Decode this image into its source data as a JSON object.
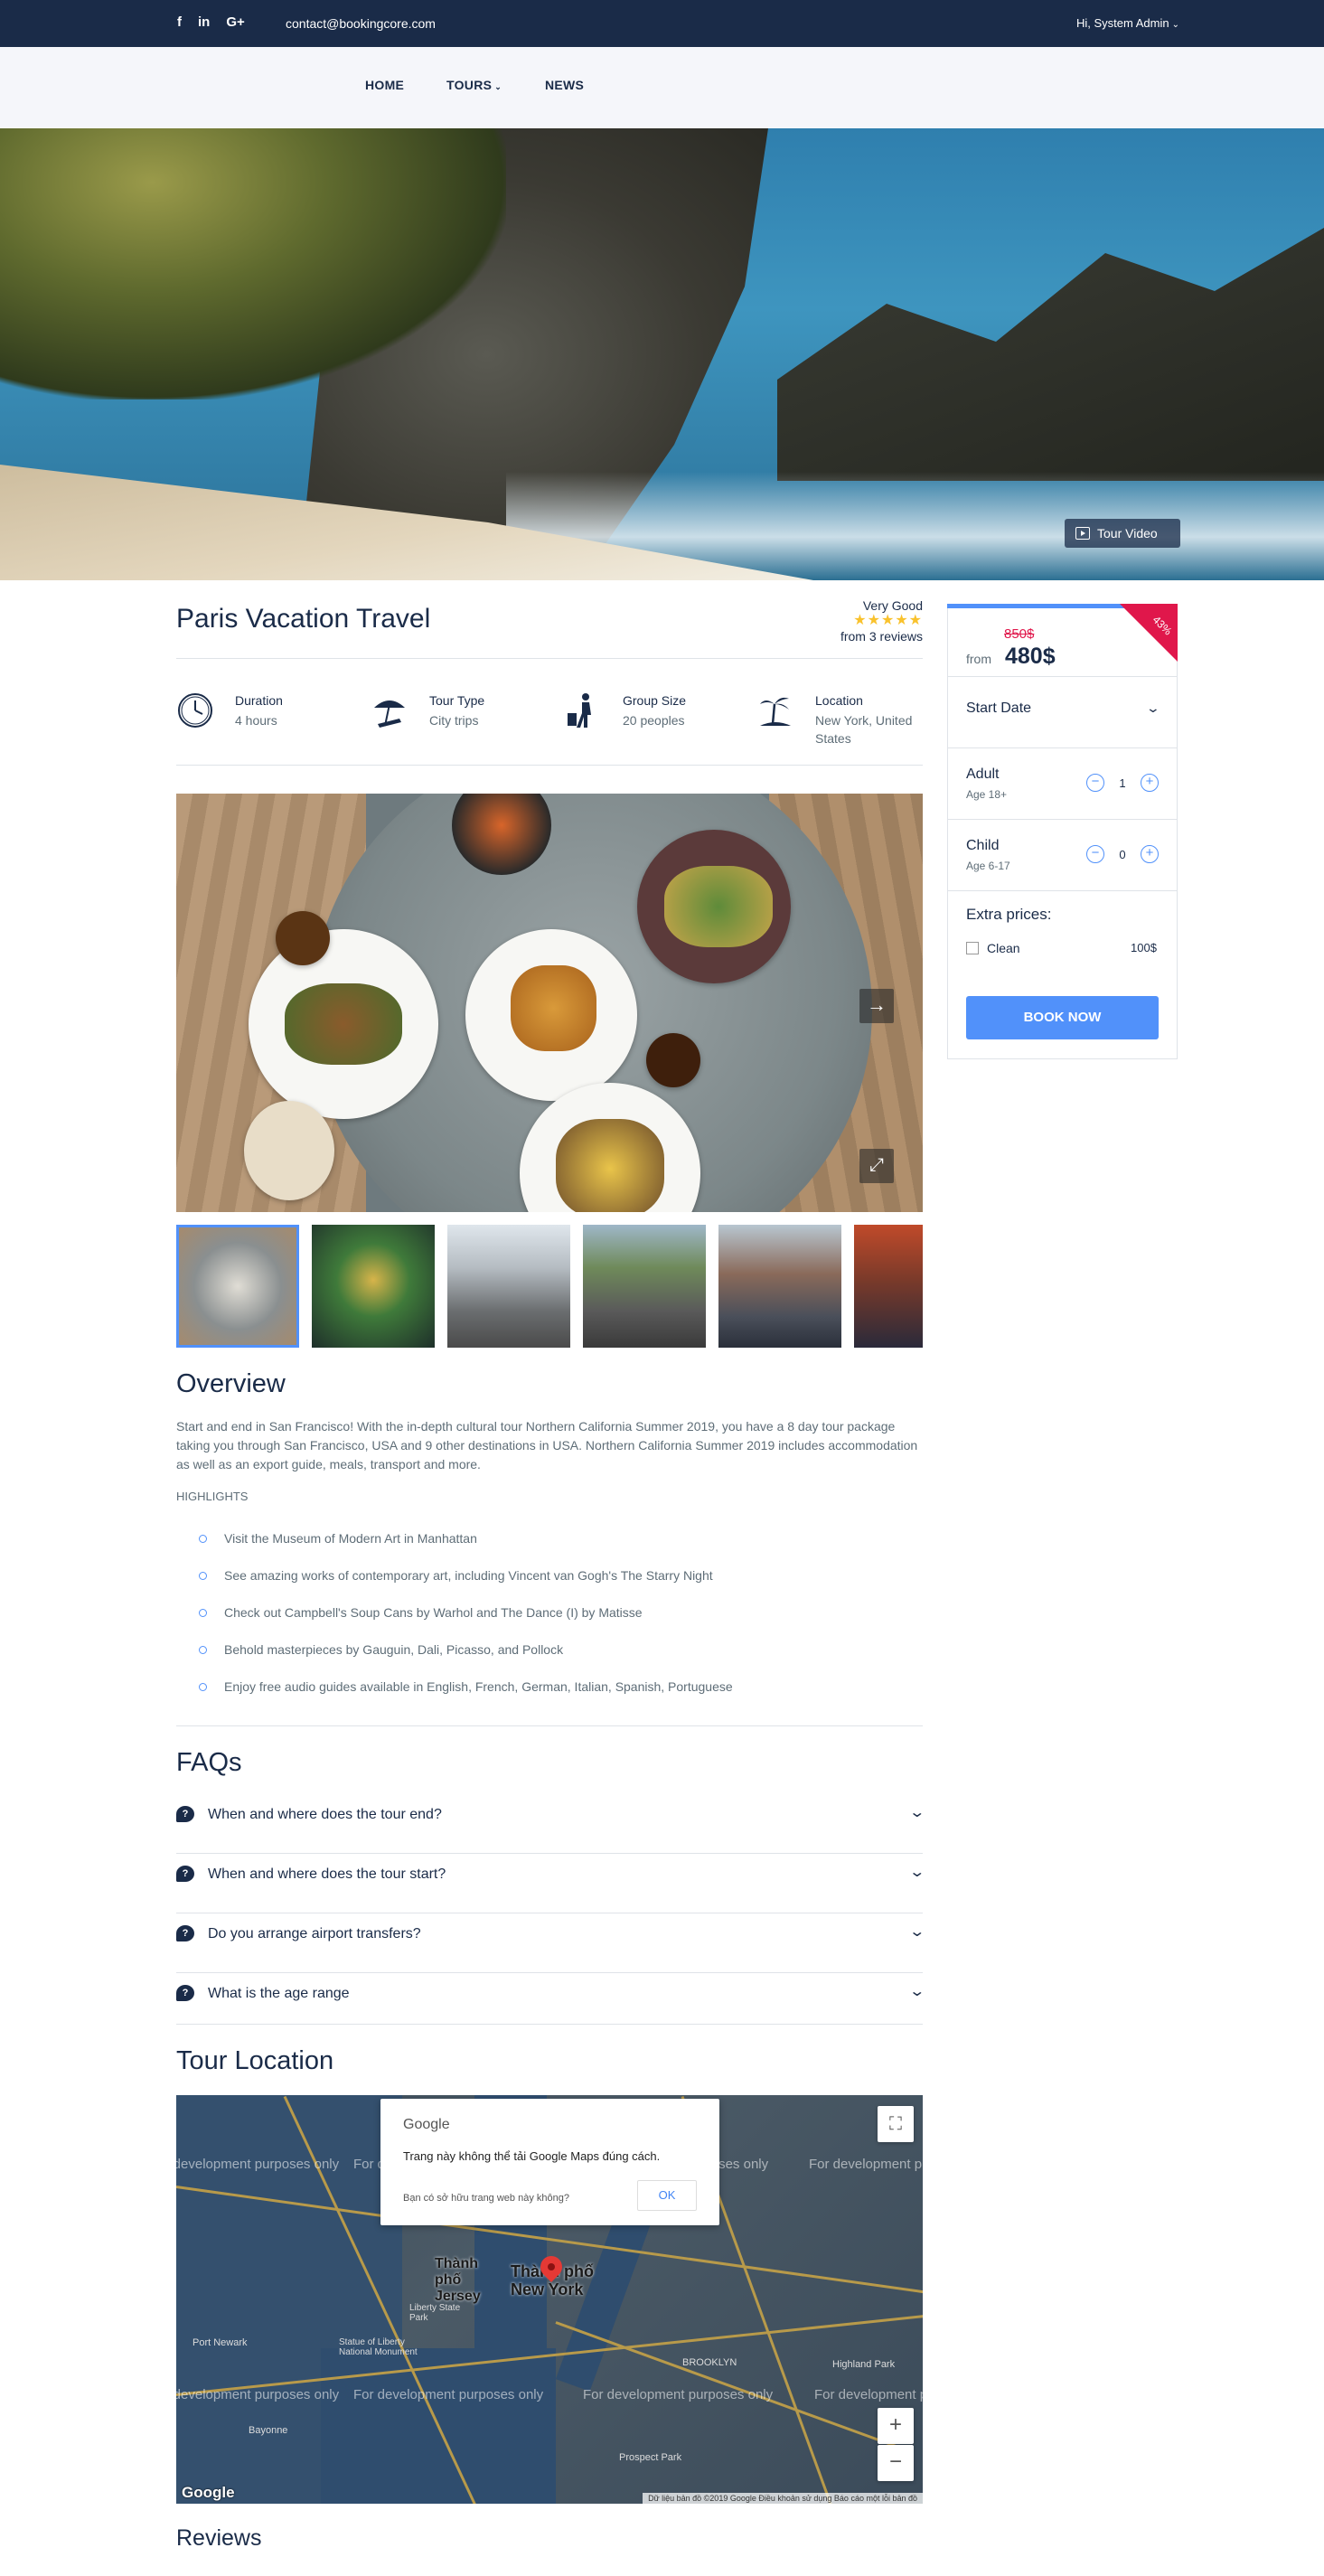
{
  "topbar": {
    "social": [
      "f",
      "in",
      "G+"
    ],
    "email": "contact@bookingcore.com",
    "user": "Hi, System Admin",
    "user_caret": "⌄"
  },
  "nav": {
    "items": [
      {
        "label": "HOME"
      },
      {
        "label": "TOURS",
        "dropdown": true
      },
      {
        "label": "NEWS"
      }
    ],
    "caret": "⌄"
  },
  "hero": {
    "video_label": "Tour Video"
  },
  "tour": {
    "title": "Paris Vacation Travel",
    "rating_label": "Very Good",
    "stars": "★★★★★",
    "rating_value": 5,
    "reviews": "from 3 reviews"
  },
  "info": [
    {
      "label": "Duration",
      "value": "4 hours",
      "icon": "clock-icon"
    },
    {
      "label": "Tour Type",
      "value": "City trips",
      "icon": "beach-umbrella-icon"
    },
    {
      "label": "Group Size",
      "value": "20 peoples",
      "icon": "traveler-icon"
    },
    {
      "label": "Location",
      "value": "New York, United States",
      "icon": "palm-island-icon"
    }
  ],
  "gallery": {
    "next_icon": "→",
    "fullscreen_icon": "⤢",
    "thumbs": [
      "food-table",
      "salad-bowl",
      "city-street",
      "motorbike-rider",
      "market-street",
      "night-street"
    ]
  },
  "overview": {
    "heading": "Overview",
    "text": "Start and end in San Francisco! With the in-depth cultural tour Northern California Summer 2019, you have a 8 day tour package taking you through San Francisco, USA and 9 other destinations in USA. Northern California Summer 2019 includes accommodation as well as an export guide, meals, transport and more.",
    "highlights_title": "HIGHLIGHTS",
    "highlights": [
      "Visit the Museum of Modern Art in Manhattan",
      "See amazing works of contemporary art, including Vincent van Gogh's The Starry Night",
      "Check out Campbell's Soup Cans by Warhol and The Dance (I) by Matisse",
      "Behold masterpieces by Gauguin, Dali, Picasso, and Pollock",
      "Enjoy free audio guides available in English, French, German, Italian, Spanish, Portuguese"
    ]
  },
  "faqs": {
    "heading": "FAQs",
    "icon": "?",
    "chevron": "⌄",
    "items": [
      "When and where does the tour end?",
      "When and where does the tour start?",
      "Do you arrange airport transfers?",
      "What is the age range"
    ]
  },
  "location": {
    "heading": "Tour Location",
    "dev_text": "For development purposes only",
    "dialog": {
      "brand": "Google",
      "message": "Trang này không thể tải Google Maps đúng cách.",
      "owner_question": "Bạn có sở hữu trang web này không?",
      "ok": "OK"
    },
    "cities": [
      "Thành phố Jersey",
      "Thành phố New York"
    ],
    "places": [
      "Port Newark",
      "Liberty State Park",
      "Statue of Liberty National Monument",
      "BROOKLYN",
      "Prospect Park",
      "Bayonne",
      "Highland Park"
    ],
    "zoom_in": "+",
    "zoom_out": "−",
    "fullscreen": "⛶",
    "footer": "Dữ liệu bản đồ ©2019 Google   Điều khoản sử dụng   Báo cáo một lỗi bản đồ",
    "logo": "Google"
  },
  "reviews": {
    "heading": "Reviews"
  },
  "booking": {
    "discount": "43%",
    "old_price": "850$",
    "from": "from",
    "price": "480$",
    "start_date": "Start Date",
    "adult": {
      "label": "Adult",
      "sub": "Age 18+",
      "count": "1"
    },
    "child": {
      "label": "Child",
      "sub": "Age 6-17",
      "count": "0"
    },
    "extra_title": "Extra prices:",
    "extra": {
      "label": "Clean",
      "price": "100$"
    },
    "book_now": "BOOK NOW"
  },
  "colors": {
    "dark_blue": "#1a2b48",
    "accent_blue": "#5191fa",
    "ribbon_red": "#e0174b",
    "star_yellow": "#f9c22d"
  }
}
